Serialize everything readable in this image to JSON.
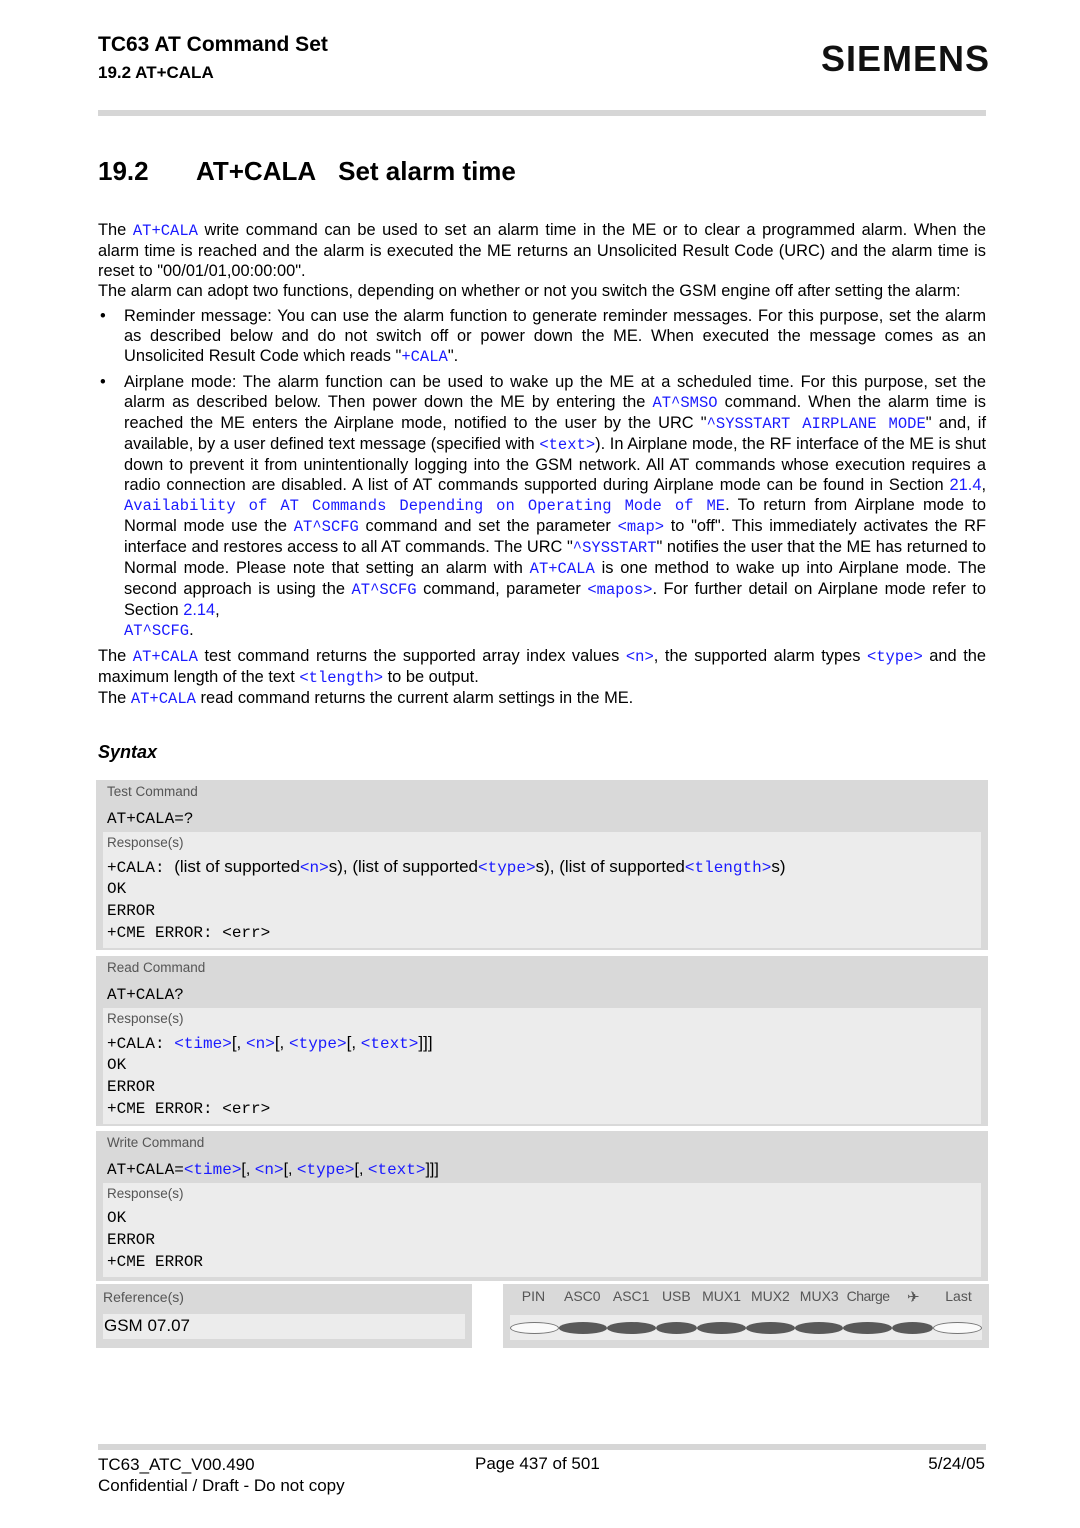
{
  "header": {
    "title": "TC63 AT Command Set",
    "subtitle": "19.2 AT+CALA",
    "logo": "SIEMENS"
  },
  "heading": {
    "number": "19.2",
    "command": "AT+CALA",
    "title": "Set alarm time"
  },
  "intro": {
    "p1_a": "The ",
    "p1_link": "AT+CALA",
    "p1_b": " write command can be used to set an alarm time in the ME or to clear a programmed alarm. When the alarm time is reached and the alarm is executed the ME returns an Unsolicited Result Code (URC) and the alarm time is reset to \"00/01/01,00:00:00\".",
    "p2": "The alarm can adopt two functions, depending on whether or not you switch the GSM engine off after setting the alarm:"
  },
  "bullets": {
    "reminder": {
      "a": "Reminder message: You can use the alarm function to generate reminder messages. For this purpose, set the alarm as described below and do not switch off or power down the ME. When executed the message comes as an Unsolicited Result Code which reads \"",
      "link": "+CALA",
      "b": "\"."
    },
    "airplane": {
      "t1": "Airplane mode: The alarm function can be used to wake up the ME at a scheduled time. For this purpose, set the alarm as described below. Then power down the ME by entering the ",
      "l1": "AT^SMSO",
      "t2": " command. When the alarm time is reached the ME enters the Airplane mode, notified to the user by the URC \"",
      "l2": "^SYSSTART AIRPLANE MODE",
      "t3": "\" and, if available, by a user defined text message (specified with ",
      "l3": "<text>",
      "t4": "). In Airplane mode, the RF interface of the ME is shut down to prevent it from unintentionally logging into the GSM network. All AT commands whose execution requires a radio connection are disabled. A list of AT commands supported during Airplane mode can be found in Section ",
      "l4": "21.4",
      "t5": ", ",
      "l5": "Availability of AT Commands Depending on Operating Mode of ME",
      "t6": ". To return from Airplane mode to Normal mode use the ",
      "l6": "AT^SCFG",
      "t7": " command and set the parameter ",
      "l7": "<map>",
      "t8": " to \"off\". This immediately activates the RF interface and restores access to all AT commands. The URC \"",
      "l8": "^SYSSTART",
      "t9": "\" notifies the user that the ME has returned to Normal mode. Please note that setting an alarm with ",
      "l9": "AT+CALA",
      "t10": " is one method to wake up into Airplane mode. The second approach is using the ",
      "l10": "AT^SCFG",
      "t11": " command, parameter ",
      "l11": "<mapos>",
      "t12": ". For further detail on Airplane mode refer to Section ",
      "l12": "2.14",
      "t13": ", ",
      "l13": "AT^SCFG",
      "t14": "."
    }
  },
  "outro": {
    "p3": {
      "a": "The ",
      "l1": "AT+CALA",
      "b": " test command returns the supported array index values ",
      "l2": "<n>",
      "c": ", the supported alarm types ",
      "l3": "<type>",
      "d": " and the maximum length of the text ",
      "l4": "<tlength>",
      "e": " to be output."
    },
    "p4": {
      "a": "The ",
      "l1": "AT+CALA",
      "b": " read command returns the current alarm settings in the ME."
    }
  },
  "syntax": {
    "title": "Syntax",
    "response_label": "Response(s)",
    "test": {
      "label": "Test Command",
      "command": "AT+CALA=?",
      "resp_prefix": "+CALA: ",
      "resp_t1": " (list of supported",
      "resp_p1": "<n>",
      "resp_t2": "s), (list of supported",
      "resp_p2": "<type>",
      "resp_t3": "s), (list of supported",
      "resp_p3": "<tlength>",
      "resp_t4": "s)",
      "lines": [
        "OK",
        "ERROR",
        "+CME ERROR: <err>"
      ]
    },
    "read": {
      "label": "Read Command",
      "command": "AT+CALA?",
      "resp_prefix": "+CALA: ",
      "p_time": "<time>",
      "p_n": "<n>",
      "p_type": "<type>",
      "p_text": "<text>",
      "sep": "[, ",
      "close": "]]]",
      "lines": [
        "OK",
        "ERROR",
        "+CME ERROR: <err>"
      ]
    },
    "write": {
      "label": "Write Command",
      "command_prefix": "AT+CALA=",
      "p_time": "<time>",
      "p_n": "<n>",
      "p_type": "<type>",
      "p_text": "<text>",
      "sep": "[, ",
      "close": "]]]",
      "lines": [
        "OK",
        "ERROR",
        "+CME ERROR"
      ]
    }
  },
  "references": {
    "label": "Reference(s)",
    "value": "GSM 07.07"
  },
  "ports": {
    "headers": [
      "PIN",
      "ASC0",
      "ASC1",
      "USB",
      "MUX1",
      "MUX2",
      "MUX3",
      "Charge",
      "airplane-icon",
      "Last"
    ],
    "airplane_glyph": "✈",
    "supported": [
      false,
      true,
      true,
      true,
      true,
      true,
      true,
      true,
      true,
      false
    ]
  },
  "footer": {
    "doc_id": "TC63_ATC_V00.490",
    "confidential": "Confidential / Draft - Do not copy",
    "page": "Page 437 of 501",
    "date": "5/24/05"
  },
  "colors": {
    "link": "#1a1aff",
    "box": "#d9d9d9",
    "inner": "#ececec"
  }
}
